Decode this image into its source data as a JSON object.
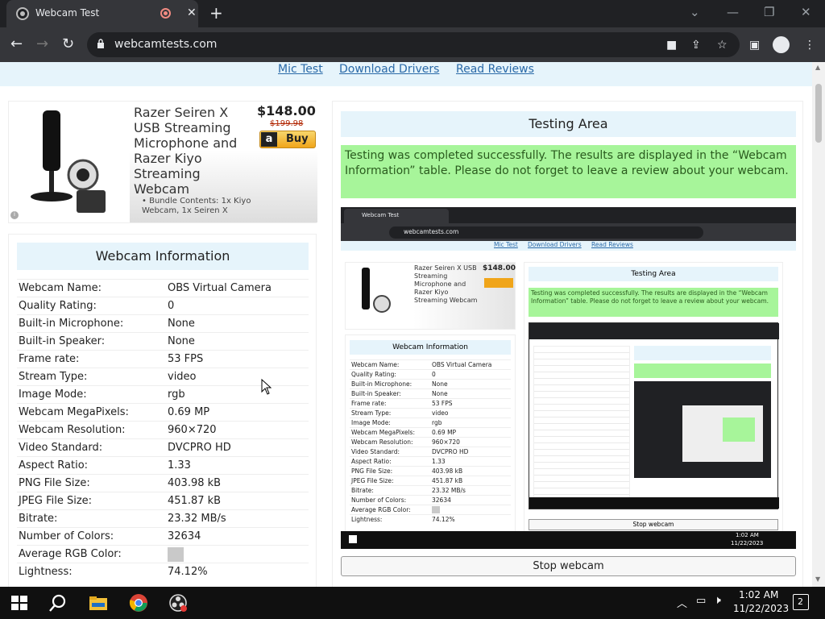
{
  "browser": {
    "tab_title": "Webcam Test",
    "url": "webcamtests.com"
  },
  "topnav": {
    "links": [
      "Mic Test",
      "Download Drivers",
      "Read Reviews"
    ]
  },
  "ad": {
    "product_name": "Razer Seiren X USB Streaming Microphone and Razer Kiyo Streaming Webcam",
    "price": "$148.00",
    "old_price": "$199.98",
    "buy_label": "Buy",
    "bundle": "Bundle Contents: 1x Kiyo Webcam, 1x Seiren X"
  },
  "webcam_info": {
    "title": "Webcam Information",
    "rows": [
      {
        "k": "Webcam Name:",
        "v": "OBS Virtual Camera"
      },
      {
        "k": "Quality Rating:",
        "v": "0"
      },
      {
        "k": "Built-in Microphone:",
        "v": "None"
      },
      {
        "k": "Built-in Speaker:",
        "v": "None"
      },
      {
        "k": "Frame rate:",
        "v": "53 FPS"
      },
      {
        "k": "Stream Type:",
        "v": "video"
      },
      {
        "k": "Image Mode:",
        "v": "rgb"
      },
      {
        "k": "Webcam MegaPixels:",
        "v": "0.69 MP"
      },
      {
        "k": "Webcam Resolution:",
        "v": "960×720"
      },
      {
        "k": "Video Standard:",
        "v": "DVCPRO HD"
      },
      {
        "k": "Aspect Ratio:",
        "v": "1.33"
      },
      {
        "k": "PNG File Size:",
        "v": "403.98 kB"
      },
      {
        "k": "JPEG File Size:",
        "v": "451.87 kB"
      },
      {
        "k": "Bitrate:",
        "v": "23.32 MB/s"
      },
      {
        "k": "Number of Colors:",
        "v": "32634"
      },
      {
        "k": "Average RGB Color:",
        "v": ""
      },
      {
        "k": "Lightness:",
        "v": "74.12%"
      }
    ],
    "avg_color": "#c9c9c9"
  },
  "testing": {
    "title": "Testing Area",
    "message": "Testing was completed successfully. The results are displayed in the “Webcam Information” table. Please do not forget to leave a review about your webcam.",
    "stop_label": "Stop webcam"
  },
  "nested": {
    "tab_title": "Webcam Test",
    "url": "webcamtests.com",
    "stop_label": "Stop webcam",
    "clock_time": "1:02 AM",
    "clock_date": "11/22/2023"
  },
  "taskbar": {
    "time": "1:02 AM",
    "date": "11/22/2023",
    "notifications": "2"
  },
  "colors": {
    "success_bg": "#a7f59a",
    "header_bg": "#e6f4fb",
    "link": "#2b6aa8"
  }
}
